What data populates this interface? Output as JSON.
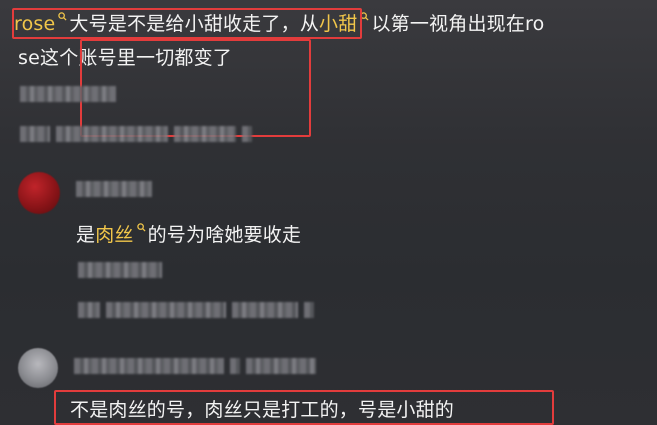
{
  "comment1": {
    "mention": "rose",
    "mention_icon": "search-icon",
    "text_a": "大号是不是给小甜收走了，从",
    "link2": "小甜",
    "link2_icon": "search-icon",
    "text_b": "以第一视角出现在ro",
    "line2": "se这个账号里一切都变了"
  },
  "comment2": {
    "avatar": "red-avatar",
    "prefix": "是",
    "link": "肉丝",
    "link_icon": "search-icon",
    "suffix": "的号为啥她要收走"
  },
  "comment3": {
    "avatar": "gray-avatar",
    "text": "不是肉丝的号，肉丝只是打工的，号是小甜的"
  },
  "colors": {
    "background": "#2e2f33",
    "text": "#f3f3f3",
    "link": "#f1c64a",
    "highlight_box": "#e23c3c"
  }
}
